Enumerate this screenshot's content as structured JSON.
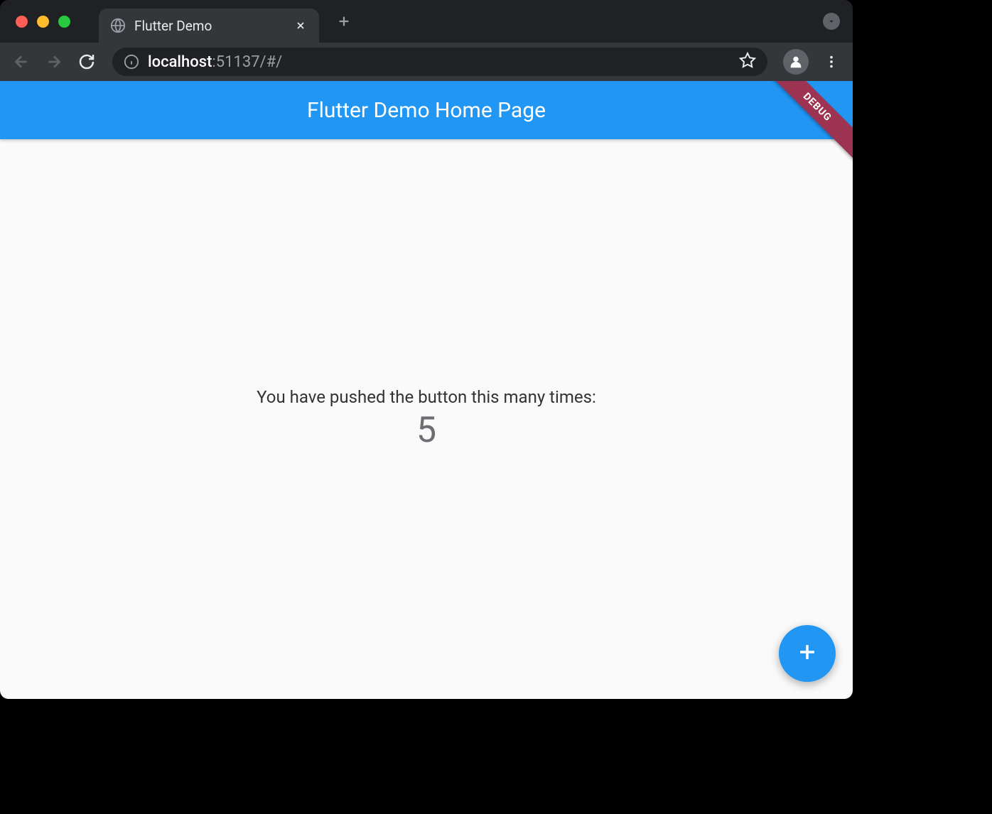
{
  "browser": {
    "tab": {
      "title": "Flutter Demo"
    },
    "url": {
      "host": "localhost",
      "path": ":51137/#/"
    }
  },
  "app": {
    "title": "Flutter Demo Home Page",
    "debug_label": "DEBUG",
    "counter": {
      "label": "You have pushed the button this many times:",
      "value": "5"
    }
  },
  "colors": {
    "primary": "#2196f3",
    "debug_banner": "#9c3352"
  }
}
